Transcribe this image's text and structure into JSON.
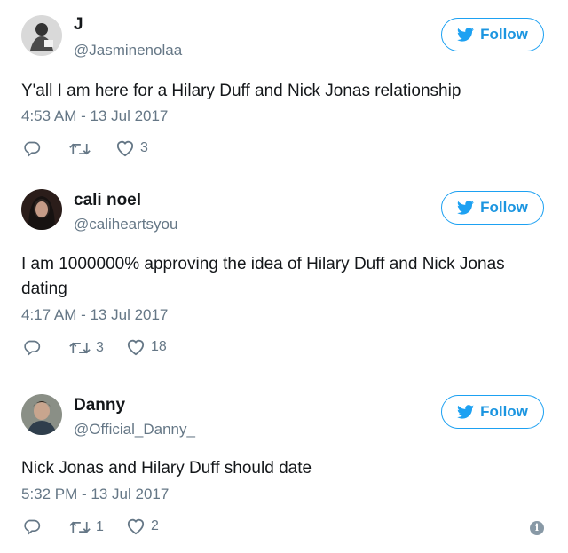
{
  "follow_label": "Follow",
  "icons": {
    "reply": "reply-icon",
    "retweet": "retweet-icon",
    "like": "heart-icon",
    "follow": "twitter-bird-icon",
    "info": "info-icon"
  },
  "colors": {
    "accent": "#1da1f2",
    "text": "#14171a",
    "muted": "#657786"
  },
  "tweets": [
    {
      "name": "J",
      "handle": "@Jasminenolaa",
      "text": "Y'all I am here for a Hilary Duff and Nick Jonas relationship",
      "timestamp": "4:53 AM - 13 Jul 2017",
      "retweets": "",
      "likes": "3"
    },
    {
      "name": "cali noel",
      "handle": "@caliheartsyou",
      "text": "I am 1000000% approving the idea of Hilary Duff and Nick Jonas dating",
      "timestamp": "4:17 AM - 13 Jul 2017",
      "retweets": "3",
      "likes": "18"
    },
    {
      "name": "Danny",
      "handle": "@Official_Danny_",
      "text": "Nick Jonas and Hilary Duff should date",
      "timestamp": "5:32 PM - 13 Jul 2017",
      "retweets": "1",
      "likes": "2"
    }
  ],
  "info_glyph": "i"
}
